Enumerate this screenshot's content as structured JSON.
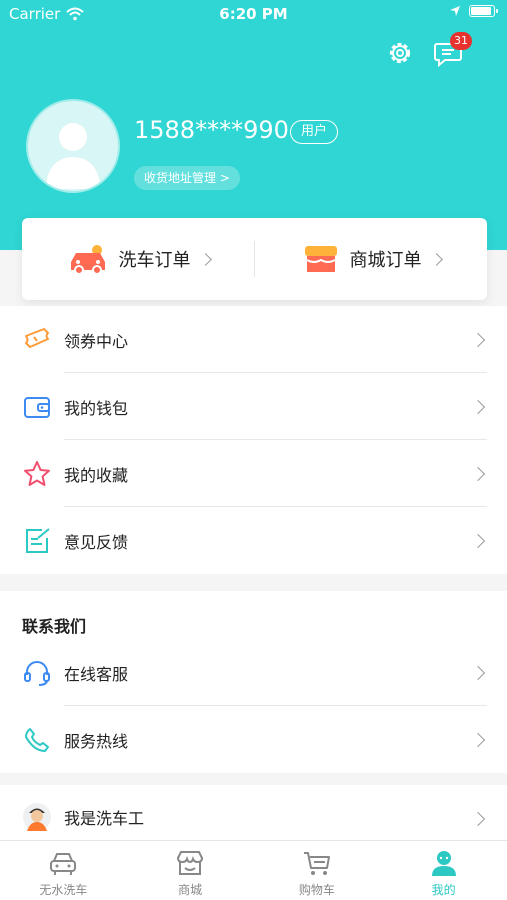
{
  "status_bar": {
    "carrier": "Carrier",
    "time": "6:20 PM"
  },
  "header": {
    "settings_icon": "gear-icon",
    "message_icon": "chat-bubble-icon",
    "unread_count": "31"
  },
  "profile": {
    "phone": "1588****990",
    "role": "用户",
    "address_link": "收货地址管理 >"
  },
  "orders": [
    {
      "label": "洗车订单",
      "icon": "car-wash-icon"
    },
    {
      "label": "商城订单",
      "icon": "shop-icon"
    }
  ],
  "menu": [
    {
      "label": "领券中心",
      "icon": "coupon-icon"
    },
    {
      "label": "我的钱包",
      "icon": "wallet-icon"
    },
    {
      "label": "我的收藏",
      "icon": "star-icon"
    },
    {
      "label": "意见反馈",
      "icon": "edit-icon"
    }
  ],
  "contact": {
    "title": "联系我们",
    "items": [
      {
        "label": "在线客服",
        "icon": "headset-icon"
      },
      {
        "label": "服务热线",
        "icon": "phone-icon"
      }
    ]
  },
  "washer": {
    "label": "我是洗车工",
    "icon": "washer-avatar-icon"
  },
  "tabs": [
    {
      "label": "无水洗车",
      "icon": "car-icon"
    },
    {
      "label": "商城",
      "icon": "store-icon"
    },
    {
      "label": "购物车",
      "icon": "cart-icon"
    },
    {
      "label": "我的",
      "icon": "user-icon",
      "active": true
    }
  ],
  "colors": {
    "accent": "#2fd6d3",
    "tab_active": "#2cc8c4",
    "badge": "#e8322f"
  }
}
